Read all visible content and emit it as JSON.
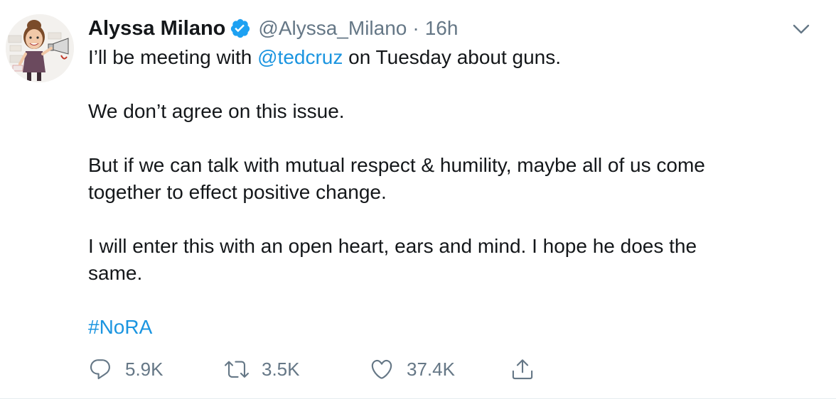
{
  "tweet": {
    "display_name": "Alyssa Milano",
    "handle": "@Alyssa_Milano",
    "separator": "·",
    "time": "16h",
    "line1_prefix": "I’ll be meeting with ",
    "mention": "@tedcruz",
    "line1_suffix": " on Tuesday about guns.",
    "para2": "We don’t agree on this issue.",
    "para3_line1": "But if we can talk with mutual respect & humility, maybe all of us come",
    "para3_line2": "together to effect positive change.",
    "para4_line1": "I will enter this with an open heart, ears and mind. I hope he does the",
    "para4_line2": "same.",
    "hashtag": "#NoRA"
  },
  "actions": {
    "reply": {
      "icon": "reply-icon",
      "count": "5.9K"
    },
    "retweet": {
      "icon": "retweet-icon",
      "count": "3.5K"
    },
    "like": {
      "icon": "heart-icon",
      "count": "37.4K"
    },
    "share": {
      "icon": "share-icon"
    }
  },
  "colors": {
    "link": "#1b95e0",
    "secondary_text": "#657786",
    "verified_badge": "#1da1f2",
    "primary_text": "#14171a"
  }
}
